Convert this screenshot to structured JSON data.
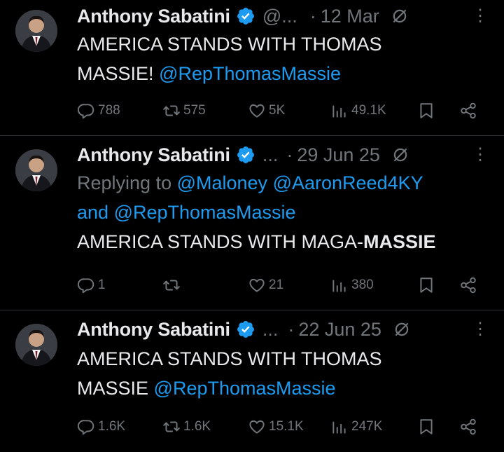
{
  "tweets": [
    {
      "name": "Anthony Sabatini",
      "handle": "@...",
      "date": "12 Mar",
      "text_parts": [
        "AMERICA STANDS WITH THOMAS ",
        "MASSIE! ",
        "@RepThomasMassie"
      ],
      "stats": {
        "replies": "788",
        "retweets": "575",
        "likes": "5K",
        "views": "49.1K"
      }
    },
    {
      "name": "Anthony Sabatini",
      "handle": "...",
      "date": "29 Jun 25",
      "replying_label": "Replying to ",
      "replying_mentions": [
        "@Maloney",
        "@AaronReed4KY"
      ],
      "replying_and": "and",
      "replying_last": "@RepThomasMassie",
      "text_plain": "AMERICA STANDS WITH MAGA-",
      "text_bold": "MASSIE",
      "stats": {
        "replies": "1",
        "retweets": "",
        "likes": "21",
        "views": "380"
      }
    },
    {
      "name": "Anthony Sabatini",
      "handle": "...",
      "date": "22 Jun 25",
      "text_parts": [
        "AMERICA STANDS WITH THOMAS ",
        "MASSIE ",
        "@RepThomasMassie"
      ],
      "stats": {
        "replies": "1.6K",
        "retweets": "1.6K",
        "likes": "15.1K",
        "views": "247K"
      }
    }
  ],
  "ui": {
    "dot": "·",
    "more": "⋮",
    "colors": {
      "background": "#000000",
      "text": "#e7e9ea",
      "muted": "#71767b",
      "link": "#1d9bf0",
      "verified": "#1d9bf0",
      "divider": "#2f3336"
    },
    "icons": [
      "verified-badge-icon",
      "grok-icon",
      "more-icon",
      "reply-icon",
      "retweet-icon",
      "like-icon",
      "views-icon",
      "bookmark-icon",
      "share-icon"
    ]
  }
}
